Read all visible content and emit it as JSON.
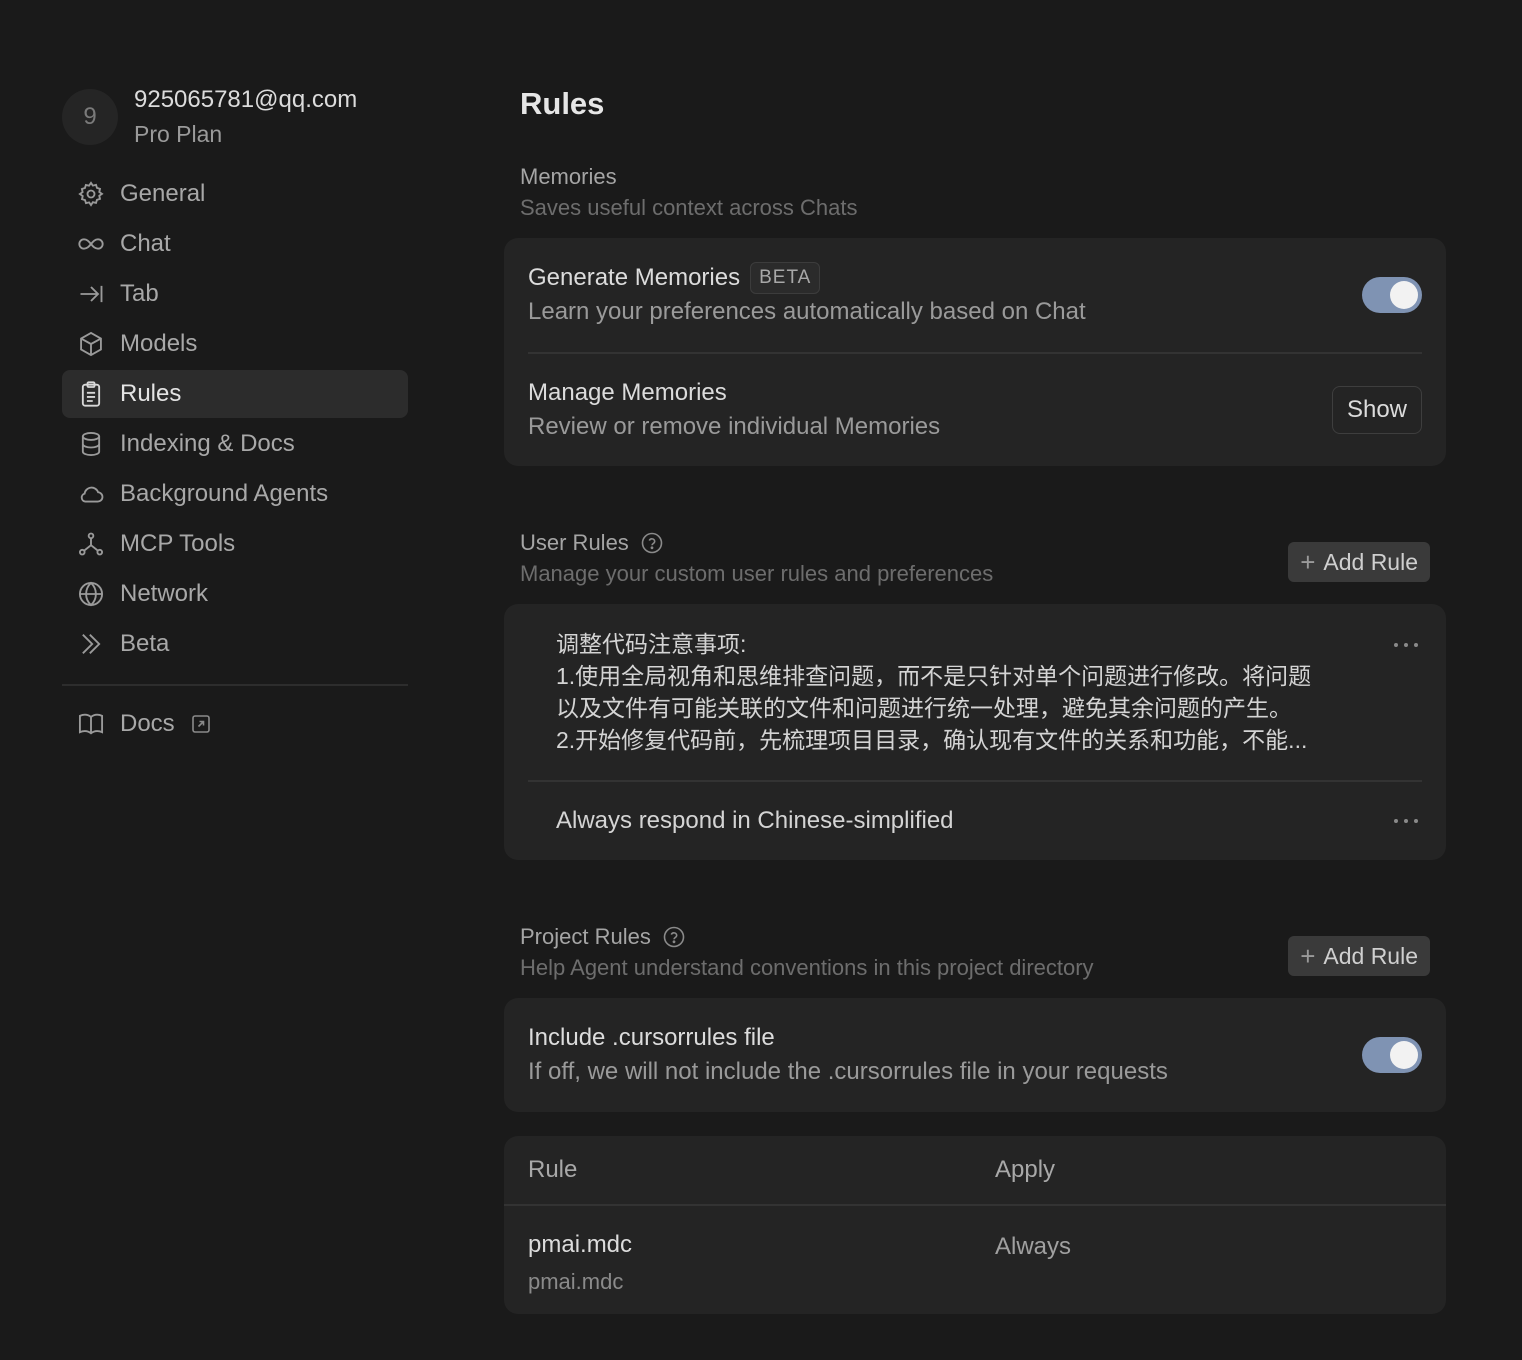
{
  "account": {
    "avatar_letter": "9",
    "email": "925065781@qq.com",
    "plan": "Pro Plan"
  },
  "sidebar": {
    "items": [
      {
        "label": "General",
        "icon": "gear-icon"
      },
      {
        "label": "Chat",
        "icon": "infinity-icon"
      },
      {
        "label": "Tab",
        "icon": "tab-arrow-icon"
      },
      {
        "label": "Models",
        "icon": "cube-icon"
      },
      {
        "label": "Rules",
        "icon": "clipboard-icon",
        "active": true
      },
      {
        "label": "Indexing & Docs",
        "icon": "database-icon"
      },
      {
        "label": "Background Agents",
        "icon": "cloud-icon"
      },
      {
        "label": "MCP Tools",
        "icon": "nodes-icon"
      },
      {
        "label": "Network",
        "icon": "globe-icon"
      },
      {
        "label": "Beta",
        "icon": "chevrons-icon"
      }
    ],
    "docs_label": "Docs"
  },
  "page": {
    "title": "Rules"
  },
  "memories": {
    "title": "Memories",
    "subtitle": "Saves useful context across Chats",
    "generate": {
      "title": "Generate Memories",
      "badge": "BETA",
      "desc": "Learn your preferences automatically based on Chat",
      "enabled": true
    },
    "manage": {
      "title": "Manage Memories",
      "desc": "Review or remove individual Memories",
      "button": "Show"
    }
  },
  "user_rules": {
    "title": "User Rules",
    "subtitle": "Manage your custom user rules and preferences",
    "add_button": "Add Rule",
    "rules": [
      "调整代码注意事项:\n1.使用全局视角和思维排查问题，而不是只针对单个问题进行修改。将问题\n以及文件有可能关联的文件和问题进行统一处理，避免其余问题的产生。\n2.开始修复代码前，先梳理项目目录，确认现有文件的关系和功能，不能...",
      "Always respond in Chinese-simplified"
    ]
  },
  "project_rules": {
    "title": "Project Rules",
    "subtitle": "Help Agent understand conventions in this project directory",
    "add_button": "Add Rule",
    "cursorrules": {
      "title": "Include .cursorrules file",
      "desc": "If off, we will not include the .cursorrules file in your requests",
      "enabled": true
    },
    "table": {
      "headers": [
        "Rule",
        "Apply"
      ],
      "rows": [
        {
          "name": "pmai.mdc",
          "path": "pmai.mdc",
          "apply": "Always"
        }
      ]
    }
  },
  "colors": {
    "background": "#1a1a1a",
    "card": "#242424",
    "toggle_on": "#7f93b3"
  }
}
